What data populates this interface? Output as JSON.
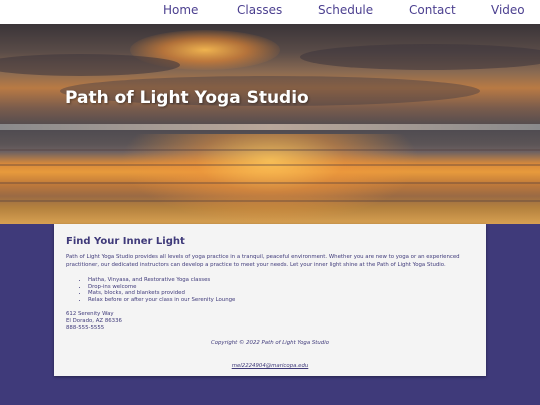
{
  "nav": {
    "items": [
      {
        "label": "Home"
      },
      {
        "label": "Classes"
      },
      {
        "label": "Schedule"
      },
      {
        "label": "Contact"
      },
      {
        "label": "Video"
      }
    ]
  },
  "hero": {
    "title": "Path of Light Yoga Studio",
    "image_icon": "sunset-over-water-image"
  },
  "main": {
    "heading": "Find Your Inner Light",
    "intro": "Path of Light Yoga Studio provides all levels of yoga practice in a tranquil, peaceful environment. Whether you are new to yoga or an experienced practitioner, our dedicated instructors can develop a practice to meet your needs. Let your inner light shine at the Path of Light Yoga Studio.",
    "features": [
      "Hatha, Vinyasa, and Restorative Yoga classes",
      "Drop-ins welcome",
      "Mats, blocks, and blankets provided",
      "Relax before or after your class in our Serenity Lounge"
    ],
    "address": {
      "street": "612 Serenity Way",
      "city": "El Dorado, AZ 86336",
      "phone": "888-555-5555"
    }
  },
  "footer": {
    "copyright": "Copyright © 2022 Path of Light Yoga Studio",
    "email": "mel2224904@maricopa.edu"
  },
  "colors": {
    "brand_purple": "#3f3a7a",
    "nav_text": "#4b3f8f",
    "card_bg": "#f4f4f4"
  }
}
